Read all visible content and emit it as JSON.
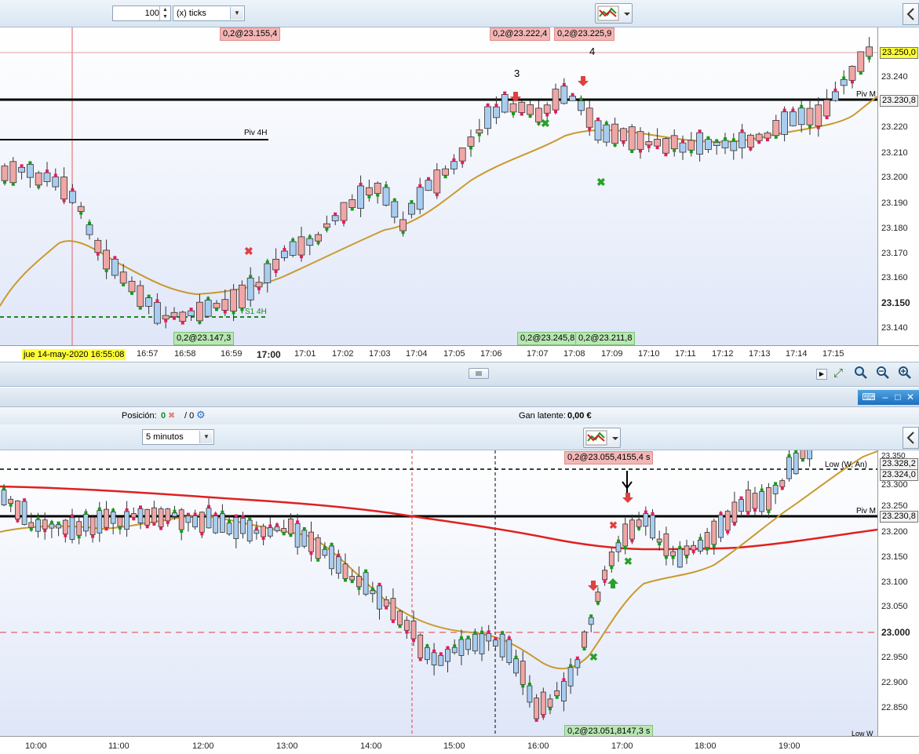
{
  "top_toolbar": {
    "quantity": "100",
    "interval": "(x) ticks"
  },
  "top_chart": {
    "price_ticks": [
      "23.240",
      "23.230,8",
      "23.220",
      "23.210",
      "23.200",
      "23.190",
      "23.180",
      "23.170",
      "23.160",
      "23.150",
      "23.140"
    ],
    "current_price": "23.250,0",
    "pivot_price": "23.230,8",
    "pivot_label": "Piv M",
    "piv4h_label": "Piv 4H",
    "s14h_label": "S1 4H",
    "cursor_time": "jue 14-may-2020 16:55:08",
    "time_ticks": [
      "16:57",
      "16:58",
      "16:59",
      "17:00",
      "17:01",
      "17:02",
      "17:03",
      "17:04",
      "17:05",
      "17:06",
      "17:07",
      "17:08",
      "17:09",
      "17:10",
      "17:11",
      "17:12",
      "17:13",
      "17:14",
      "17:15"
    ],
    "sell_tags": [
      "0,2@23.155,4",
      "0,2@23.222,4",
      "0,2@23.225,9"
    ],
    "buy_tags": [
      "0,2@23.147,3",
      "0,2@23.245,8",
      "0,2@23.211,8"
    ],
    "wave_labels": [
      "3",
      "4"
    ],
    "colors": {
      "up": "#a9cdf0",
      "down": "#f0a6a6",
      "ma": "#c99a2e",
      "pivot": "#000000",
      "support": "#1a8a1a"
    }
  },
  "position_bar": {
    "position_label": "Posición:",
    "position_value": "0",
    "orders_value": "/ 0",
    "pnl_label": "Gan latente:",
    "pnl_value": "0,00 €"
  },
  "bottom_toolbar": {
    "interval": "5 minutos"
  },
  "bottom_chart": {
    "price_ticks": [
      "23.350",
      "23.300",
      "23.250",
      "23.200",
      "23.150",
      "23.100",
      "23.050",
      "23.000",
      "22.950",
      "22.900",
      "22.850"
    ],
    "price_box_1": "23.328,2",
    "price_box_2": "23.324,0",
    "pivot_price": "23.230,8",
    "pivot_label": "Piv M",
    "low_label": "Low (W, An)",
    "low_w_label": "Low W",
    "time_ticks": [
      "10:00",
      "11:00",
      "12:00",
      "13:00",
      "14:00",
      "15:00",
      "16:00",
      "17:00",
      "18:00",
      "19:00"
    ],
    "sell_tag": "0,2@23.055,4",
    "sell_tag_time": "155,4 s",
    "buy_tag": "0,2@23.051,8",
    "buy_tag_time": "147,3 s",
    "colors": {
      "ma_slow": "#e02020",
      "ma_fast": "#c99a2e"
    }
  }
}
